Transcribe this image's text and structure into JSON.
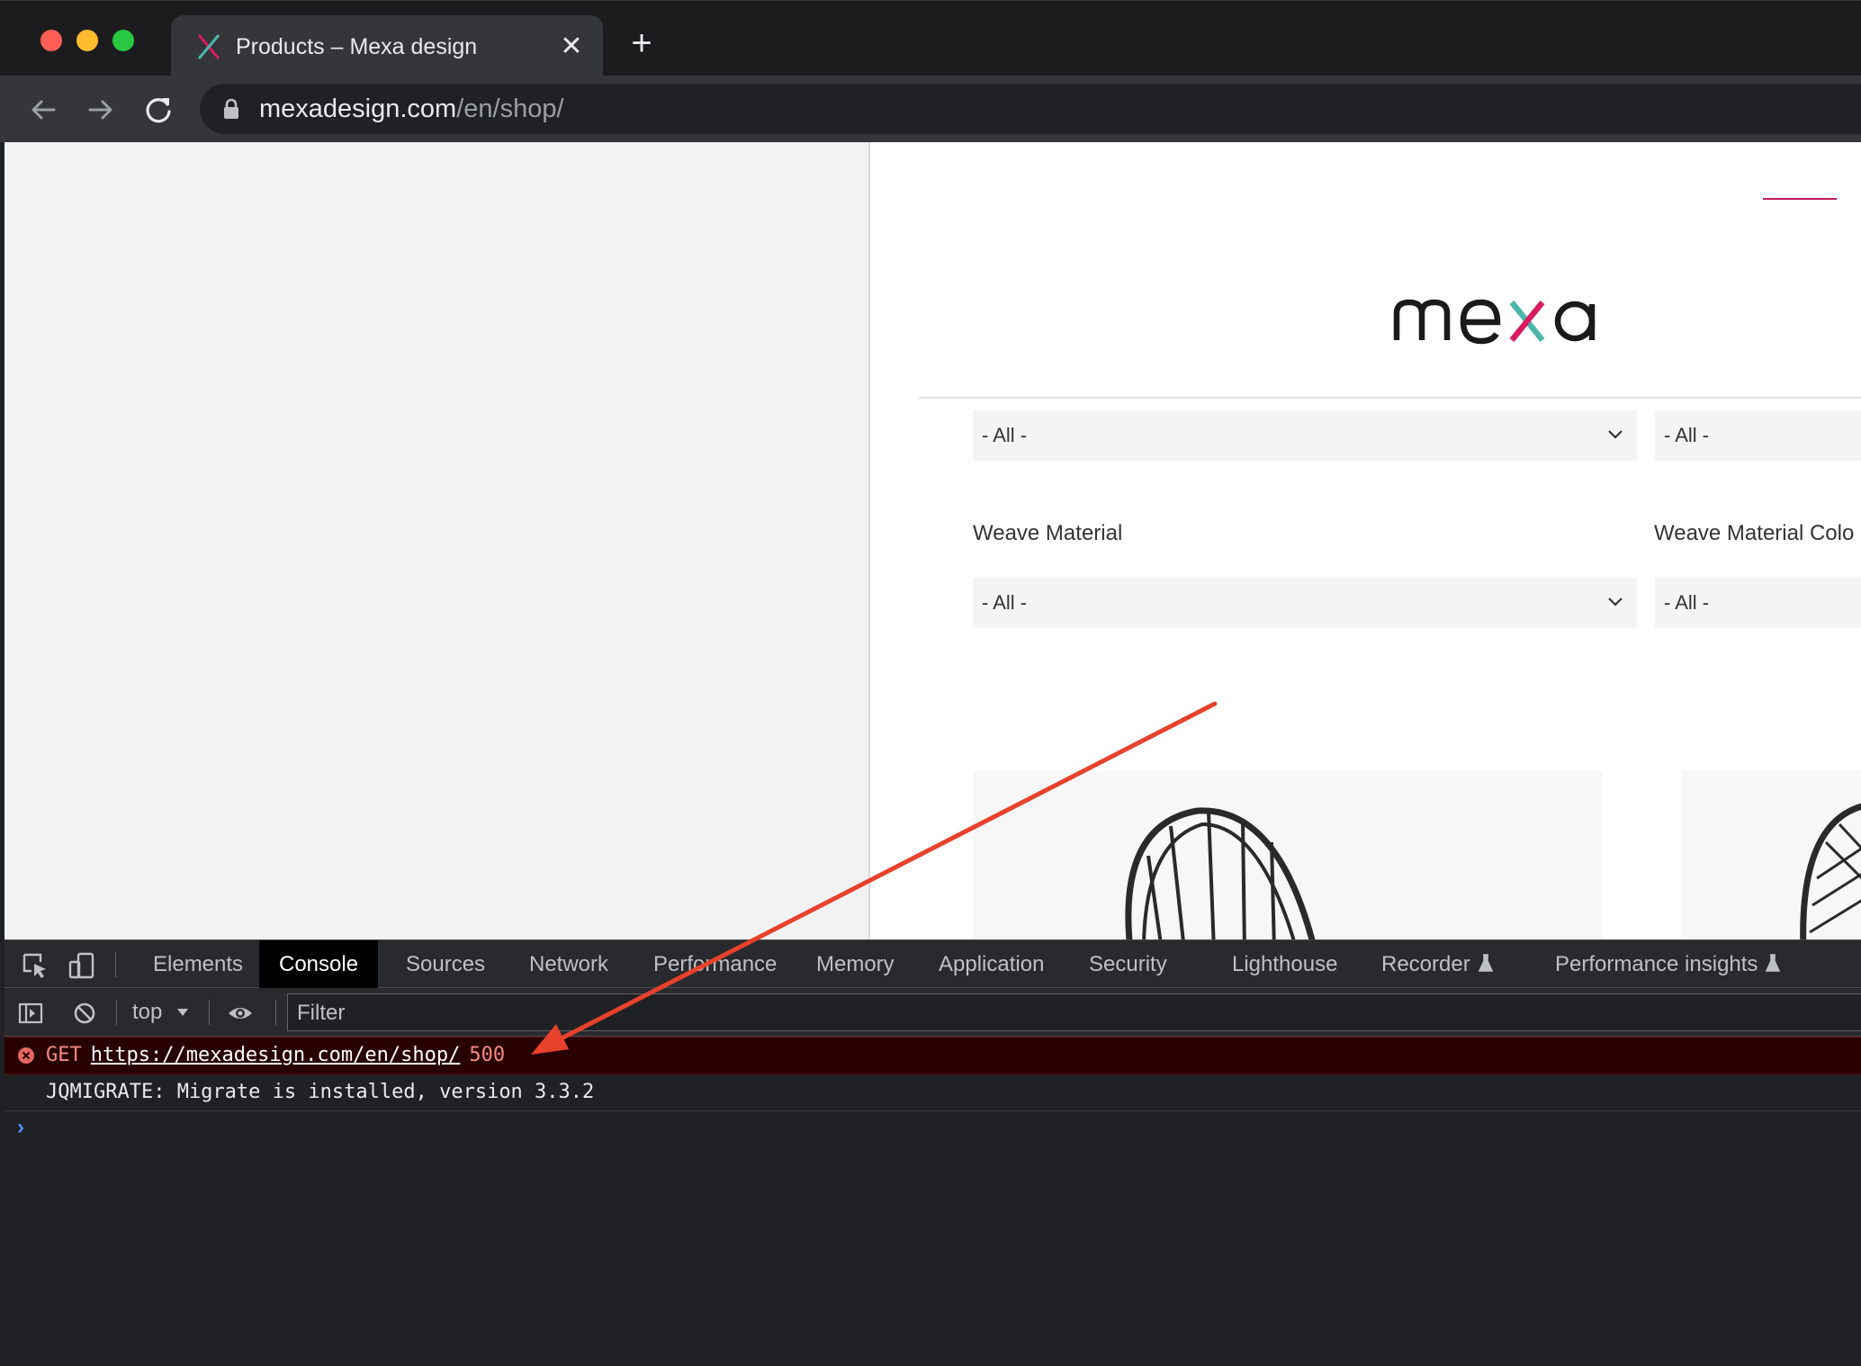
{
  "browser": {
    "tab_title": "Products – Mexa design",
    "close_symbol": "✕",
    "new_tab_symbol": "+",
    "url_host": "mexadesign.com",
    "url_path": "/en/shop/"
  },
  "site": {
    "filters": [
      {
        "value": "- All -"
      },
      {
        "value": "- All -"
      },
      {
        "value": "- All -"
      },
      {
        "value": "- All -"
      }
    ],
    "labels": {
      "weave_material": "Weave Material",
      "weave_material_color": "Weave Material Colo"
    },
    "colors": {
      "accent": "#c2185b",
      "logo_teal": "#4db6ac",
      "logo_pink": "#d81b60"
    }
  },
  "devtools": {
    "tabs": [
      "Elements",
      "Console",
      "Sources",
      "Network",
      "Performance",
      "Memory",
      "Application",
      "Security",
      "Lighthouse",
      "Recorder",
      "Performance insights"
    ],
    "active_tab": "Console",
    "context": "top",
    "filter_placeholder": "Filter",
    "console": {
      "error": {
        "method": "GET",
        "url": "https://mexadesign.com/en/shop/",
        "status": "500"
      },
      "info": "JQMIGRATE: Migrate is installed, version 3.3.2",
      "prompt": "›"
    }
  },
  "annotation": {
    "type": "arrow",
    "color": "#e8412c"
  }
}
